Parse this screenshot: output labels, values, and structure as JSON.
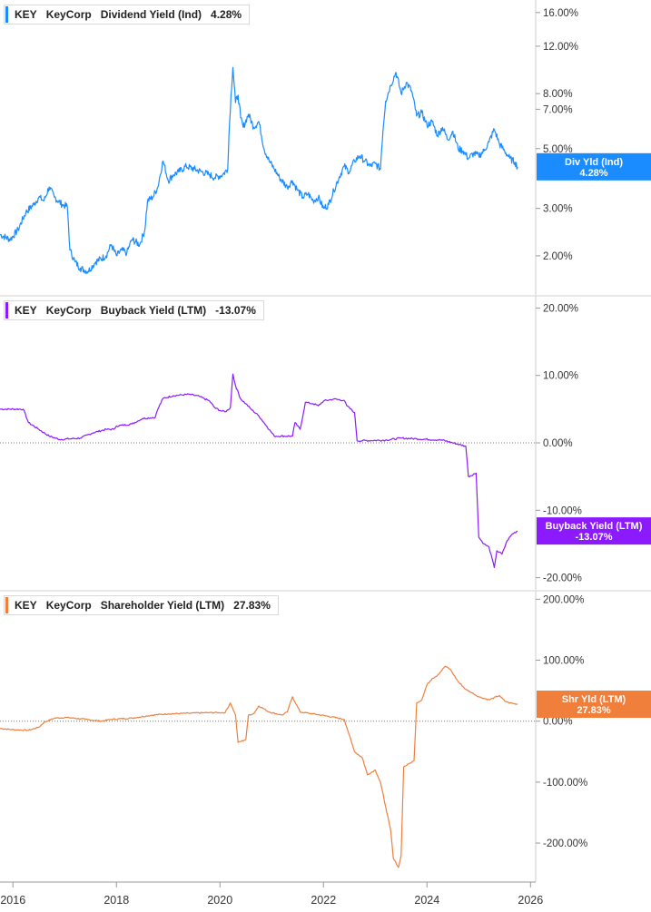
{
  "chart_data": [
    {
      "type": "line",
      "legend": {
        "ticker": "KEY",
        "company": "KeyCorp",
        "metric": "Dividend Yield (Ind)",
        "value": "4.28%"
      },
      "flag": {
        "label": "Div Yld (Ind)",
        "value": "4.28%"
      },
      "color": "#1a8cff",
      "y_scale": "log",
      "ylim": [
        1.5,
        17
      ],
      "yticks": [
        {
          "v": 2,
          "label": "2.00%"
        },
        {
          "v": 3,
          "label": "3.00%"
        },
        {
          "v": 5,
          "label": "5.00%"
        },
        {
          "v": 7,
          "label": "7.00%"
        },
        {
          "v": 8,
          "label": "8.00%"
        },
        {
          "v": 12,
          "label": "12.00%"
        },
        {
          "v": 16,
          "label": "16.00%"
        }
      ],
      "series": [
        {
          "values": [
            [
              2015.75,
              2.4
            ],
            [
              2015.95,
              2.3
            ],
            [
              2016.1,
              2.5
            ],
            [
              2016.25,
              2.9
            ],
            [
              2016.4,
              3.1
            ],
            [
              2016.5,
              3.3
            ],
            [
              2016.6,
              3.2
            ],
            [
              2016.7,
              3.6
            ],
            [
              2016.8,
              3.3
            ],
            [
              2016.95,
              3.1
            ],
            [
              2017.05,
              3.05
            ],
            [
              2017.1,
              2.1
            ],
            [
              2017.2,
              1.9
            ],
            [
              2017.3,
              1.8
            ],
            [
              2017.45,
              1.75
            ],
            [
              2017.6,
              1.9
            ],
            [
              2017.8,
              2.0
            ],
            [
              2017.9,
              2.2
            ],
            [
              2018.0,
              2.0
            ],
            [
              2018.1,
              2.1
            ],
            [
              2018.2,
              2.05
            ],
            [
              2018.3,
              2.3
            ],
            [
              2018.45,
              2.2
            ],
            [
              2018.55,
              2.5
            ],
            [
              2018.6,
              3.2
            ],
            [
              2018.7,
              3.3
            ],
            [
              2018.8,
              3.6
            ],
            [
              2018.9,
              4.5
            ],
            [
              2019.0,
              3.8
            ],
            [
              2019.1,
              4.0
            ],
            [
              2019.2,
              4.1
            ],
            [
              2019.35,
              4.3
            ],
            [
              2019.5,
              4.2
            ],
            [
              2019.65,
              4.1
            ],
            [
              2019.8,
              4.0
            ],
            [
              2019.9,
              3.9
            ],
            [
              2020.05,
              4.0
            ],
            [
              2020.15,
              4.2
            ],
            [
              2020.25,
              10.0
            ],
            [
              2020.3,
              7.4
            ],
            [
              2020.35,
              7.9
            ],
            [
              2020.4,
              6.5
            ],
            [
              2020.45,
              6.0
            ],
            [
              2020.55,
              6.7
            ],
            [
              2020.65,
              6.0
            ],
            [
              2020.75,
              6.3
            ],
            [
              2020.85,
              5.0
            ],
            [
              2020.95,
              4.5
            ],
            [
              2021.05,
              4.2
            ],
            [
              2021.15,
              3.9
            ],
            [
              2021.3,
              3.6
            ],
            [
              2021.4,
              3.8
            ],
            [
              2021.5,
              3.5
            ],
            [
              2021.6,
              3.3
            ],
            [
              2021.7,
              3.4
            ],
            [
              2021.8,
              3.2
            ],
            [
              2021.9,
              3.3
            ],
            [
              2022.0,
              3.0
            ],
            [
              2022.1,
              3.1
            ],
            [
              2022.2,
              3.5
            ],
            [
              2022.3,
              3.9
            ],
            [
              2022.4,
              4.3
            ],
            [
              2022.5,
              4.1
            ],
            [
              2022.6,
              4.5
            ],
            [
              2022.7,
              4.7
            ],
            [
              2022.8,
              4.5
            ],
            [
              2022.9,
              4.3
            ],
            [
              2023.0,
              4.4
            ],
            [
              2023.1,
              4.2
            ],
            [
              2023.2,
              7.5
            ],
            [
              2023.3,
              8.6
            ],
            [
              2023.4,
              9.6
            ],
            [
              2023.5,
              8.0
            ],
            [
              2023.6,
              8.8
            ],
            [
              2023.7,
              8.2
            ],
            [
              2023.8,
              6.6
            ],
            [
              2023.9,
              6.8
            ],
            [
              2024.0,
              6.1
            ],
            [
              2024.1,
              6.3
            ],
            [
              2024.2,
              5.6
            ],
            [
              2024.3,
              6.0
            ],
            [
              2024.4,
              5.4
            ],
            [
              2024.5,
              5.8
            ],
            [
              2024.6,
              5.0
            ],
            [
              2024.7,
              4.9
            ],
            [
              2024.8,
              4.6
            ],
            [
              2024.9,
              4.8
            ],
            [
              2025.0,
              4.7
            ],
            [
              2025.1,
              4.9
            ],
            [
              2025.2,
              5.3
            ],
            [
              2025.3,
              5.9
            ],
            [
              2025.4,
              5.2
            ],
            [
              2025.5,
              4.9
            ],
            [
              2025.6,
              4.6
            ],
            [
              2025.7,
              4.45
            ],
            [
              2025.75,
              4.28
            ]
          ]
        }
      ]
    },
    {
      "type": "line",
      "legend": {
        "ticker": "KEY",
        "company": "KeyCorp",
        "metric": "Buyback Yield (LTM)",
        "value": "-13.07%"
      },
      "flag": {
        "label": "Buyback Yield (LTM)",
        "value": "-13.07%"
      },
      "color": "#8c1aff",
      "y_scale": "linear",
      "ylim": [
        -21,
        21
      ],
      "zero_line": true,
      "yticks": [
        {
          "v": 20,
          "label": "20.00%"
        },
        {
          "v": 10,
          "label": "10.00%"
        },
        {
          "v": 0,
          "label": "0.00%"
        },
        {
          "v": -10,
          "label": "-10.00%"
        },
        {
          "v": -20,
          "label": "-20.00%"
        }
      ],
      "series": [
        {
          "values": [
            [
              2015.75,
              5.0
            ],
            [
              2016.2,
              5.0
            ],
            [
              2016.3,
              3.0
            ],
            [
              2016.5,
              2.0
            ],
            [
              2016.7,
              1.0
            ],
            [
              2016.9,
              0.5
            ],
            [
              2017.3,
              0.7
            ],
            [
              2017.55,
              1.5
            ],
            [
              2017.8,
              2.0
            ],
            [
              2017.95,
              2.0
            ],
            [
              2018.0,
              2.5
            ],
            [
              2018.3,
              2.8
            ],
            [
              2018.5,
              3.6
            ],
            [
              2018.75,
              3.8
            ],
            [
              2018.8,
              5.0
            ],
            [
              2018.9,
              6.6
            ],
            [
              2019.1,
              7.0
            ],
            [
              2019.4,
              7.2
            ],
            [
              2019.6,
              6.9
            ],
            [
              2019.8,
              6.2
            ],
            [
              2019.9,
              5.2
            ],
            [
              2020.0,
              4.8
            ],
            [
              2020.1,
              4.6
            ],
            [
              2020.2,
              5.2
            ],
            [
              2020.25,
              10.2
            ],
            [
              2020.3,
              8.5
            ],
            [
              2020.4,
              6.5
            ],
            [
              2020.5,
              5.8
            ],
            [
              2020.6,
              5.0
            ],
            [
              2020.75,
              4.0
            ],
            [
              2020.9,
              2.5
            ],
            [
              2021.05,
              1.0
            ],
            [
              2021.4,
              1.0
            ],
            [
              2021.45,
              3.0
            ],
            [
              2021.55,
              2.0
            ],
            [
              2021.65,
              6.0
            ],
            [
              2021.8,
              5.8
            ],
            [
              2021.9,
              5.5
            ],
            [
              2022.0,
              6.2
            ],
            [
              2022.2,
              6.5
            ],
            [
              2022.4,
              6.3
            ],
            [
              2022.45,
              5.5
            ],
            [
              2022.6,
              4.5
            ],
            [
              2022.65,
              0.3
            ],
            [
              2023.2,
              0.4
            ],
            [
              2023.5,
              0.7
            ],
            [
              2023.8,
              0.6
            ],
            [
              2024.3,
              0.4
            ],
            [
              2024.75,
              -0.5
            ],
            [
              2024.8,
              -5.0
            ],
            [
              2024.95,
              -4.5
            ],
            [
              2025.0,
              -14.0
            ],
            [
              2025.1,
              -15.0
            ],
            [
              2025.2,
              -15.5
            ],
            [
              2025.3,
              -18.5
            ],
            [
              2025.35,
              -16.0
            ],
            [
              2025.45,
              -16.5
            ],
            [
              2025.55,
              -14.5
            ],
            [
              2025.65,
              -13.5
            ],
            [
              2025.75,
              -13.07
            ]
          ]
        }
      ]
    },
    {
      "type": "line",
      "legend": {
        "ticker": "KEY",
        "company": "KeyCorp",
        "metric": "Shareholder Yield (LTM)",
        "value": "27.83%"
      },
      "flag": {
        "label": "Shr Yld (LTM)",
        "value": "27.83%"
      },
      "color": "#f07f3c",
      "y_scale": "linear",
      "ylim": [
        -255,
        205
      ],
      "zero_line": true,
      "yticks": [
        {
          "v": 200,
          "label": "200.00%"
        },
        {
          "v": 100,
          "label": "100.00%"
        },
        {
          "v": 0,
          "label": "0.00%"
        },
        {
          "v": -100,
          "label": "-100.00%"
        },
        {
          "v": -200,
          "label": "-200.00%"
        }
      ],
      "series": [
        {
          "values": [
            [
              2015.75,
              -12
            ],
            [
              2016.0,
              -14
            ],
            [
              2016.3,
              -15
            ],
            [
              2016.5,
              -10
            ],
            [
              2016.6,
              -2
            ],
            [
              2016.8,
              5
            ],
            [
              2017.05,
              6
            ],
            [
              2017.4,
              3
            ],
            [
              2017.7,
              0
            ],
            [
              2017.9,
              3
            ],
            [
              2018.3,
              5
            ],
            [
              2018.7,
              10
            ],
            [
              2019.0,
              12
            ],
            [
              2019.4,
              13
            ],
            [
              2019.8,
              14
            ],
            [
              2020.1,
              14
            ],
            [
              2020.2,
              30
            ],
            [
              2020.3,
              10
            ],
            [
              2020.35,
              -35
            ],
            [
              2020.5,
              -30
            ],
            [
              2020.55,
              10
            ],
            [
              2020.65,
              12
            ],
            [
              2020.75,
              25
            ],
            [
              2020.95,
              15
            ],
            [
              2021.2,
              10
            ],
            [
              2021.3,
              15
            ],
            [
              2021.4,
              40
            ],
            [
              2021.55,
              15
            ],
            [
              2021.8,
              12
            ],
            [
              2022.1,
              8
            ],
            [
              2022.4,
              3
            ],
            [
              2022.45,
              -10
            ],
            [
              2022.6,
              -50
            ],
            [
              2022.75,
              -60
            ],
            [
              2022.85,
              -88
            ],
            [
              2023.0,
              -80
            ],
            [
              2023.1,
              -100
            ],
            [
              2023.2,
              -140
            ],
            [
              2023.3,
              -180
            ],
            [
              2023.35,
              -225
            ],
            [
              2023.45,
              -240
            ],
            [
              2023.5,
              -220
            ],
            [
              2023.55,
              -75
            ],
            [
              2023.65,
              -70
            ],
            [
              2023.75,
              -65
            ],
            [
              2023.8,
              30
            ],
            [
              2023.9,
              35
            ],
            [
              2024.0,
              60
            ],
            [
              2024.1,
              70
            ],
            [
              2024.2,
              75
            ],
            [
              2024.35,
              90
            ],
            [
              2024.45,
              85
            ],
            [
              2024.6,
              65
            ],
            [
              2024.75,
              52
            ],
            [
              2024.9,
              45
            ],
            [
              2025.0,
              40
            ],
            [
              2025.2,
              35
            ],
            [
              2025.4,
              42
            ],
            [
              2025.5,
              33
            ],
            [
              2025.6,
              30
            ],
            [
              2025.75,
              27.83
            ]
          ]
        }
      ]
    }
  ],
  "x_axis": {
    "xlim": [
      2015.75,
      2026.1
    ],
    "ticks": [
      {
        "v": 2016,
        "label": "2016"
      },
      {
        "v": 2018,
        "label": "2018"
      },
      {
        "v": 2020,
        "label": "2020"
      },
      {
        "v": 2022,
        "label": "2022"
      },
      {
        "v": 2024,
        "label": "2024"
      },
      {
        "v": 2026,
        "label": "2026"
      }
    ]
  }
}
